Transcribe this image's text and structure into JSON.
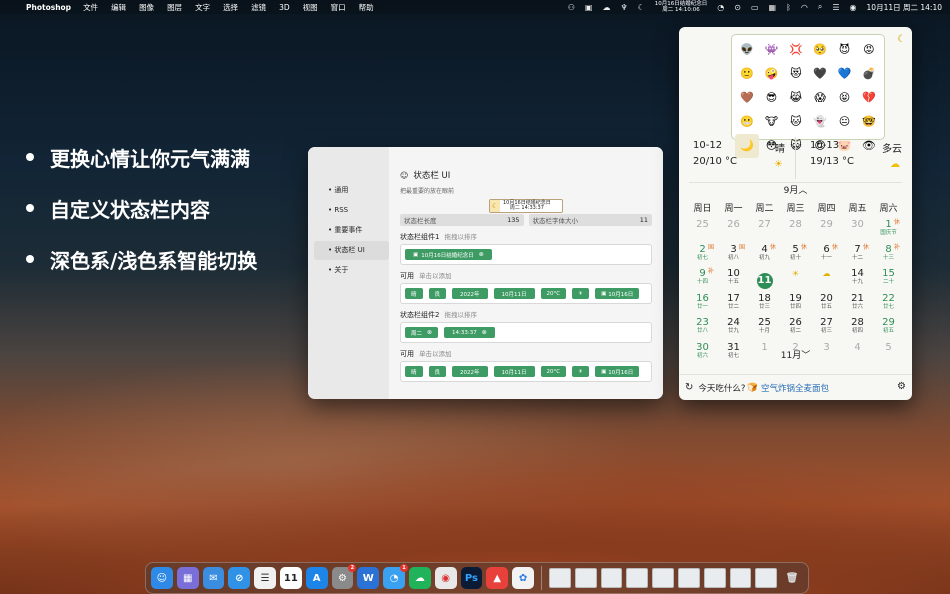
{
  "menubar": {
    "app_name": "Photoshop",
    "menus": [
      "文件",
      "编辑",
      "图像",
      "图层",
      "文字",
      "选择",
      "滤镜",
      "3D",
      "视图",
      "窗口",
      "帮助"
    ],
    "tray_reminder_line1": "10月16日结婚纪念日",
    "tray_reminder_line2": "周二 14:10:06",
    "tray_clock": "10月11日 周二 14:10"
  },
  "features": [
    "更换心情让你元气满满",
    "自定义状态栏内容",
    "深色系/浅色系智能切换"
  ],
  "settings": {
    "nav": [
      "通用",
      "RSS",
      "重要事件",
      "状态栏 UI",
      "关于"
    ],
    "active_nav": "状态栏 UI",
    "title": "状态栏 UI",
    "subtitle": "把最重要的放在眼前",
    "preview_line1": "10月16日结婚纪念日",
    "preview_line2": "周二 14:33:37",
    "length_label": "状态栏长度",
    "length_value": "135",
    "font_label": "状态栏字体大小",
    "font_value": "11",
    "group1_label": "状态栏组件1",
    "group1_hint": "拖拽以排序",
    "group1_chip": "10月16日结婚纪念日",
    "available_label": "可用",
    "available_hint": "单击以添加",
    "available_chips": [
      "晴",
      "良",
      "2022年",
      "10月11日",
      "20°C",
      "☀",
      "10月16日"
    ],
    "group2_label": "状态栏组件2",
    "group2_hint": "拖拽以排序",
    "group2_chips": [
      "周二",
      "14:33:37"
    ],
    "available2_label": "可用",
    "available2_hint": "单击以添加",
    "available2_chips": [
      "晴",
      "良",
      "2022年",
      "10月11日",
      "20°C",
      "☀",
      "10月16日"
    ]
  },
  "calendar": {
    "emojis": [
      "👽",
      "👾",
      "💢",
      "🥺",
      "😈",
      "😡",
      "🙂",
      "🤪",
      "😻",
      "🖤",
      "💙",
      "💣",
      "🤎",
      "😎",
      "😹",
      "😱",
      "😝",
      "💔",
      "😬",
      "🐮",
      "🐱",
      "👻",
      "😐",
      "🤓",
      "🌙",
      "😳",
      "😺",
      "😍",
      "🐷",
      "👁"
    ],
    "weather": [
      {
        "date": "10-12",
        "cond": "晴",
        "temp": "20/10 °C",
        "icon": "☀"
      },
      {
        "date": "10-13",
        "cond": "多云",
        "temp": "19/13 °C",
        "icon": "☁"
      }
    ],
    "month_label": "9月",
    "weekdays": [
      "周日",
      "周一",
      "周二",
      "周三",
      "周四",
      "周五",
      "周六"
    ],
    "days": [
      {
        "n": "25",
        "l": "",
        "other": true
      },
      {
        "n": "26",
        "l": "",
        "other": true
      },
      {
        "n": "27",
        "l": "",
        "other": true
      },
      {
        "n": "28",
        "l": "",
        "other": true
      },
      {
        "n": "29",
        "l": "",
        "other": true
      },
      {
        "n": "30",
        "l": "",
        "other": true
      },
      {
        "n": "1",
        "l": "国庆节",
        "badge": "休",
        "weekend": true
      },
      {
        "n": "2",
        "l": "初七",
        "badge": "国",
        "weekend": true
      },
      {
        "n": "3",
        "l": "初八",
        "badge": "国"
      },
      {
        "n": "4",
        "l": "初九",
        "badge": "休"
      },
      {
        "n": "5",
        "l": "初十",
        "badge": "休"
      },
      {
        "n": "6",
        "l": "十一",
        "badge": "休"
      },
      {
        "n": "7",
        "l": "十二",
        "badge": "休"
      },
      {
        "n": "8",
        "l": "十三",
        "badge": "补",
        "weekend": true
      },
      {
        "n": "9",
        "l": "十四",
        "badge": "补",
        "weekend": true
      },
      {
        "n": "10",
        "l": "十五"
      },
      {
        "n": "11",
        "l": "",
        "today": true
      },
      {
        "n": "",
        "l": "",
        "sun": true
      },
      {
        "n": "",
        "l": "",
        "cloud": true
      },
      {
        "n": "14",
        "l": "十九"
      },
      {
        "n": "15",
        "l": "二十",
        "weekend": true
      },
      {
        "n": "16",
        "l": "廿一",
        "weekend": true
      },
      {
        "n": "17",
        "l": "廿二"
      },
      {
        "n": "18",
        "l": "廿三"
      },
      {
        "n": "19",
        "l": "廿四"
      },
      {
        "n": "20",
        "l": "廿五"
      },
      {
        "n": "21",
        "l": "廿六"
      },
      {
        "n": "22",
        "l": "廿七",
        "weekend": true
      },
      {
        "n": "23",
        "l": "廿八",
        "weekend": true
      },
      {
        "n": "24",
        "l": "廿九"
      },
      {
        "n": "25",
        "l": "十月"
      },
      {
        "n": "26",
        "l": "初二"
      },
      {
        "n": "27",
        "l": "初三"
      },
      {
        "n": "28",
        "l": "初四"
      },
      {
        "n": "29",
        "l": "初五",
        "weekend": true
      },
      {
        "n": "30",
        "l": "初六",
        "weekend": true
      },
      {
        "n": "31",
        "l": "初七"
      },
      {
        "n": "1",
        "l": "",
        "other": true
      },
      {
        "n": "2",
        "l": "",
        "other": true
      },
      {
        "n": "3",
        "l": "",
        "other": true
      },
      {
        "n": "4",
        "l": "",
        "other": true
      },
      {
        "n": "5",
        "l": "",
        "other": true
      }
    ],
    "next_month_label": "11月",
    "footer_prefix": "今天吃什么?",
    "footer_food": "空气炸锅全麦面包"
  },
  "dock": {
    "calendar_day": "11",
    "ps_label": "Ps",
    "wps_label": "W",
    "badge_settings": "2",
    "badge_qq": "1"
  },
  "colors": {
    "accent_green": "#3e9b64",
    "calendar_green": "#2e8f56",
    "holiday_orange": "#e0742a"
  }
}
